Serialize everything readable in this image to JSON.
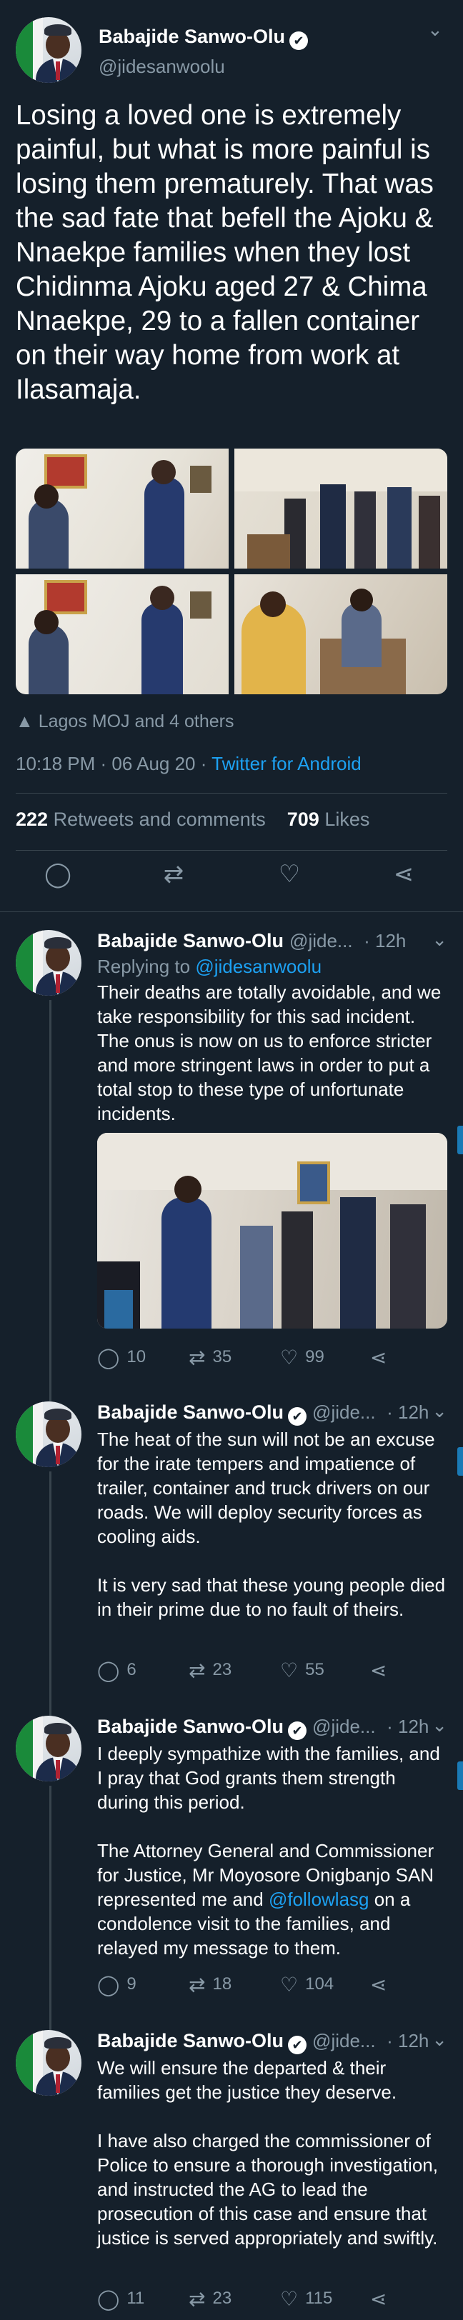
{
  "main_tweet": {
    "author_name": "Babajide Sanwo-Olu",
    "author_handle": "@jidesanwoolu",
    "verified_glyph": "✔",
    "text": "Losing a loved one is extremely painful, but what is more painful is losing them prematurely. That was the sad fate that befell the Ajoku & Nnaekpe families when they lost Chidinma Ajoku aged 27 & Chima Nnaekpe, 29 to a fallen container on their way home from work at Ilasamaja.",
    "retweeted_by": "Lagos MOJ and 4 others",
    "time": "10:18 PM · 06 Aug 20 · ",
    "client": "Twitter for Android",
    "retweets_count": "222",
    "retweets_label": "Retweets and comments",
    "likes_count": "709",
    "likes_label": "Likes",
    "icons": [
      "reply-icon",
      "retweet-icon",
      "like-icon",
      "share-icon"
    ]
  },
  "replies": [
    {
      "author_name": "Babajide Sanwo-Olu",
      "handle_short": "@jide...",
      "time_ago": "· 12h",
      "replying_prefix": "Replying to ",
      "replying_to": "@jidesanwoolu",
      "text": "Their deaths are totally avoidable, and we take responsibility for this sad incident. The onus is now on us to enforce stricter and more stringent laws in order to put a total stop to these type of unfortunate incidents.",
      "replies": "10",
      "retweets": "35",
      "likes": "99"
    },
    {
      "author_name": "Babajide Sanwo-Olu",
      "handle_short": "@jide...",
      "time_ago": "· 12h",
      "text_p1": "The heat of the sun will not be an excuse for the irate tempers and impatience of trailer, container and truck drivers on our roads. We will deploy security forces as cooling aids.",
      "text_p2": "It is very sad that these young people died in their prime due to no fault of theirs.",
      "replies": "6",
      "retweets": "23",
      "likes": "55"
    },
    {
      "author_name": "Babajide Sanwo-Olu",
      "handle_short": "@jide...",
      "time_ago": "· 12h",
      "text_p1": "I deeply sympathize with the families, and I pray that God grants them strength during this period.",
      "text_p2a": "The Attorney General and Commissioner for Justice, Mr Moyosore Onigbanjo SAN represented me and ",
      "text_p2_link": "@followlasg",
      "text_p2b": " on a condolence visit to the families, and relayed my message to them.",
      "replies": "9",
      "retweets": "18",
      "likes": "104"
    },
    {
      "author_name": "Babajide Sanwo-Olu",
      "handle_short": "@jide...",
      "time_ago": "· 12h",
      "text_p1": "We will ensure the departed & their families get the justice they deserve.",
      "text_p2": "I have also charged the commissioner of Police to ensure a thorough investigation, and instructed the AG to lead the prosecution of this case and ensure that justice is served appropriately and swiftly.",
      "replies": "11",
      "retweets": "23",
      "likes": "115"
    }
  ],
  "glyphs": {
    "chevron": "⌄",
    "reply": "◯",
    "retweet": "⇄",
    "like": "♡",
    "share": "⋖",
    "person": "👤"
  },
  "colors": {
    "background": "#15202b",
    "accent": "#1da1f2",
    "muted": "#8899a6",
    "divider": "#38444d"
  }
}
